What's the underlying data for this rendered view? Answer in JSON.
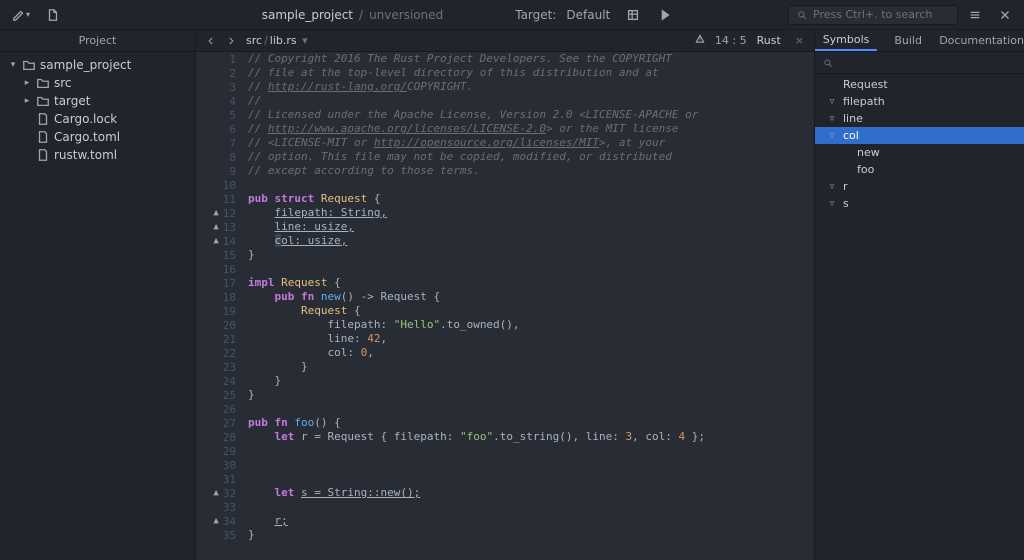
{
  "titlebar": {
    "project": "sample_project",
    "status_sep": "/",
    "status": "unversioned",
    "target_label": "Target:",
    "target_value": "Default"
  },
  "search_placeholder": "Press Ctrl+. to search",
  "sidebar": {
    "header": "Project",
    "tree": [
      {
        "indent": 0,
        "twist": "▾",
        "icon": "folder",
        "label": "sample_project"
      },
      {
        "indent": 1,
        "twist": "▸",
        "icon": "folder",
        "label": "src"
      },
      {
        "indent": 1,
        "twist": "▸",
        "icon": "folder",
        "label": "target"
      },
      {
        "indent": 1,
        "twist": "",
        "icon": "file",
        "label": "Cargo.lock"
      },
      {
        "indent": 1,
        "twist": "",
        "icon": "file",
        "label": "Cargo.toml"
      },
      {
        "indent": 1,
        "twist": "",
        "icon": "file",
        "label": "rustw.toml"
      }
    ]
  },
  "tabbar": {
    "crumb1": "src",
    "crumb_sep": "/",
    "crumb2": "lib.rs",
    "linecol": "14 : 5",
    "lang": "Rust"
  },
  "code": {
    "lines": [
      {
        "n": 1,
        "warn": false,
        "html": "<span class='c-cmt'>// Copyright 2016 The Rust Project Developers. See the COPYRIGHT</span>"
      },
      {
        "n": 2,
        "warn": false,
        "html": "<span class='c-cmt'>// file at the top-level directory of this distribution and at</span>"
      },
      {
        "n": 3,
        "warn": false,
        "html": "<span class='c-cmt'>// <span class='c-url'>http://rust-lang.org/</span>COPYRIGHT.</span>"
      },
      {
        "n": 4,
        "warn": false,
        "html": "<span class='c-cmt'>//</span>"
      },
      {
        "n": 5,
        "warn": false,
        "html": "<span class='c-cmt'>// Licensed under the Apache License, Version 2.0 &lt;LICENSE-APACHE or</span>"
      },
      {
        "n": 6,
        "warn": false,
        "html": "<span class='c-cmt'>// <span class='c-url'>http://www.apache.org/licenses/LICENSE-2.0</span>&gt; or the MIT license</span>"
      },
      {
        "n": 7,
        "warn": false,
        "html": "<span class='c-cmt'>// &lt;LICENSE-MIT or <span class='c-url'>http://opensource.org/licenses/MIT</span>&gt;, at your</span>"
      },
      {
        "n": 8,
        "warn": false,
        "html": "<span class='c-cmt'>// option. This file may not be copied, modified, or distributed</span>"
      },
      {
        "n": 9,
        "warn": false,
        "html": "<span class='c-cmt'>// except according to those terms.</span>"
      },
      {
        "n": 10,
        "warn": false,
        "html": ""
      },
      {
        "n": 11,
        "warn": false,
        "html": "<span class='c-kw'>pub</span> <span class='c-kw'>struct</span> <span class='c-ty'>Request</span> <span class='c-id'>{</span>"
      },
      {
        "n": 12,
        "warn": true,
        "html": "    <span class='c-field'>filepath: String,</span>"
      },
      {
        "n": 13,
        "warn": true,
        "html": "    <span class='c-field'>line: usize,</span>"
      },
      {
        "n": 14,
        "warn": true,
        "html": "    <span class='cursor'>c</span><span class='c-field'>ol: usize,</span>"
      },
      {
        "n": 15,
        "warn": false,
        "html": "<span class='c-id'>}</span>"
      },
      {
        "n": 16,
        "warn": false,
        "html": ""
      },
      {
        "n": 17,
        "warn": false,
        "html": "<span class='c-kw'>impl</span> <span class='c-ty'>Request</span> <span class='c-id'>{</span>"
      },
      {
        "n": 18,
        "warn": false,
        "html": "    <span class='c-kw'>pub</span> <span class='c-kw'>fn</span> <span class='c-fn'>new</span><span class='c-id'>() -&gt; Request {</span>"
      },
      {
        "n": 19,
        "warn": false,
        "html": "        <span class='c-ty'>Request</span> <span class='c-id'>{</span>"
      },
      {
        "n": 20,
        "warn": false,
        "html": "            <span class='c-id'>filepath: </span><span class='c-str'>\"Hello\"</span><span class='c-id'>.to_owned(),</span>"
      },
      {
        "n": 21,
        "warn": false,
        "html": "            <span class='c-id'>line: </span><span class='c-num'>42</span><span class='c-id'>,</span>"
      },
      {
        "n": 22,
        "warn": false,
        "html": "            <span class='c-id'>col: </span><span class='c-num'>0</span><span class='c-id'>,</span>"
      },
      {
        "n": 23,
        "warn": false,
        "html": "        <span class='c-id'>}</span>"
      },
      {
        "n": 24,
        "warn": false,
        "html": "    <span class='c-id'>}</span>"
      },
      {
        "n": 25,
        "warn": false,
        "html": "<span class='c-id'>}</span>"
      },
      {
        "n": 26,
        "warn": false,
        "html": ""
      },
      {
        "n": 27,
        "warn": false,
        "html": "<span class='c-kw'>pub</span> <span class='c-kw'>fn</span> <span class='c-fn'>foo</span><span class='c-id'>() {</span>"
      },
      {
        "n": 28,
        "warn": false,
        "html": "    <span class='c-kw'>let</span> <span class='c-id'>r = Request { filepath: </span><span class='c-str'>\"foo\"</span><span class='c-id'>.to_string(), line: </span><span class='c-num'>3</span><span class='c-id'>, col: </span><span class='c-num'>4</span><span class='c-id'> };</span>"
      },
      {
        "n": 29,
        "warn": false,
        "html": ""
      },
      {
        "n": 30,
        "warn": false,
        "html": ""
      },
      {
        "n": 31,
        "warn": false,
        "html": ""
      },
      {
        "n": 32,
        "warn": true,
        "html": "    <span class='c-kw'>let</span> <span class='c-field'>s = String::new();</span>"
      },
      {
        "n": 33,
        "warn": false,
        "html": ""
      },
      {
        "n": 34,
        "warn": true,
        "html": "    <span class='c-field'>r;</span>"
      },
      {
        "n": 35,
        "warn": false,
        "html": "<span class='c-id'>}</span>"
      }
    ]
  },
  "right": {
    "tabs": [
      "Symbols",
      "Build",
      "Documentation"
    ],
    "active_tab": 0,
    "symbols": [
      {
        "indent": 0,
        "arrow": "",
        "label": "Request"
      },
      {
        "indent": 0,
        "arrow": "▿",
        "label": "filepath"
      },
      {
        "indent": 0,
        "arrow": "▿",
        "label": "line"
      },
      {
        "indent": 0,
        "arrow": "▿",
        "label": "col",
        "selected": true
      },
      {
        "indent": 1,
        "arrow": "",
        "label": "new"
      },
      {
        "indent": 1,
        "arrow": "",
        "label": "foo"
      },
      {
        "indent": 0,
        "arrow": "▿",
        "label": "r"
      },
      {
        "indent": 0,
        "arrow": "▿",
        "label": "s"
      }
    ]
  }
}
